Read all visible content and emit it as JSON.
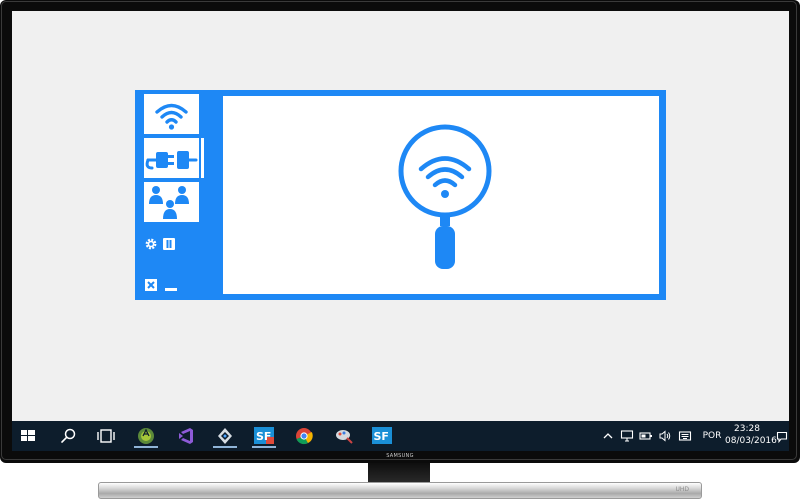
{
  "device": {
    "brand_text": "SAMSUNG",
    "stand_logo": "UHD"
  },
  "app": {
    "sidebar": {
      "tiles": [
        {
          "icon": "wifi-icon",
          "label": ""
        },
        {
          "icon": "plug-icon",
          "label": ""
        },
        {
          "icon": "users-icon",
          "label": ""
        }
      ],
      "small_icons": [
        "gear-icon",
        "info-icon"
      ],
      "window_controls": [
        "close-icon",
        "minimize-icon"
      ]
    },
    "main": {
      "illustration": "wifi-search-icon"
    },
    "colors": {
      "accent": "#1e88f5",
      "background": "#ffffff"
    }
  },
  "taskbar": {
    "pinned": [
      {
        "name": "start-icon"
      },
      {
        "name": "search-icon"
      },
      {
        "name": "task-view-icon"
      },
      {
        "name": "android-studio-icon"
      },
      {
        "name": "visual-studio-icon"
      },
      {
        "name": "unity-icon"
      },
      {
        "name": "sf-red-app-icon",
        "label": "SF"
      },
      {
        "name": "chrome-icon"
      },
      {
        "name": "paint-app-icon"
      },
      {
        "name": "sf-blue-app-icon",
        "label": "SF"
      }
    ],
    "tray": {
      "language": "POR",
      "time": "23:28",
      "date": "08/03/2016"
    }
  }
}
